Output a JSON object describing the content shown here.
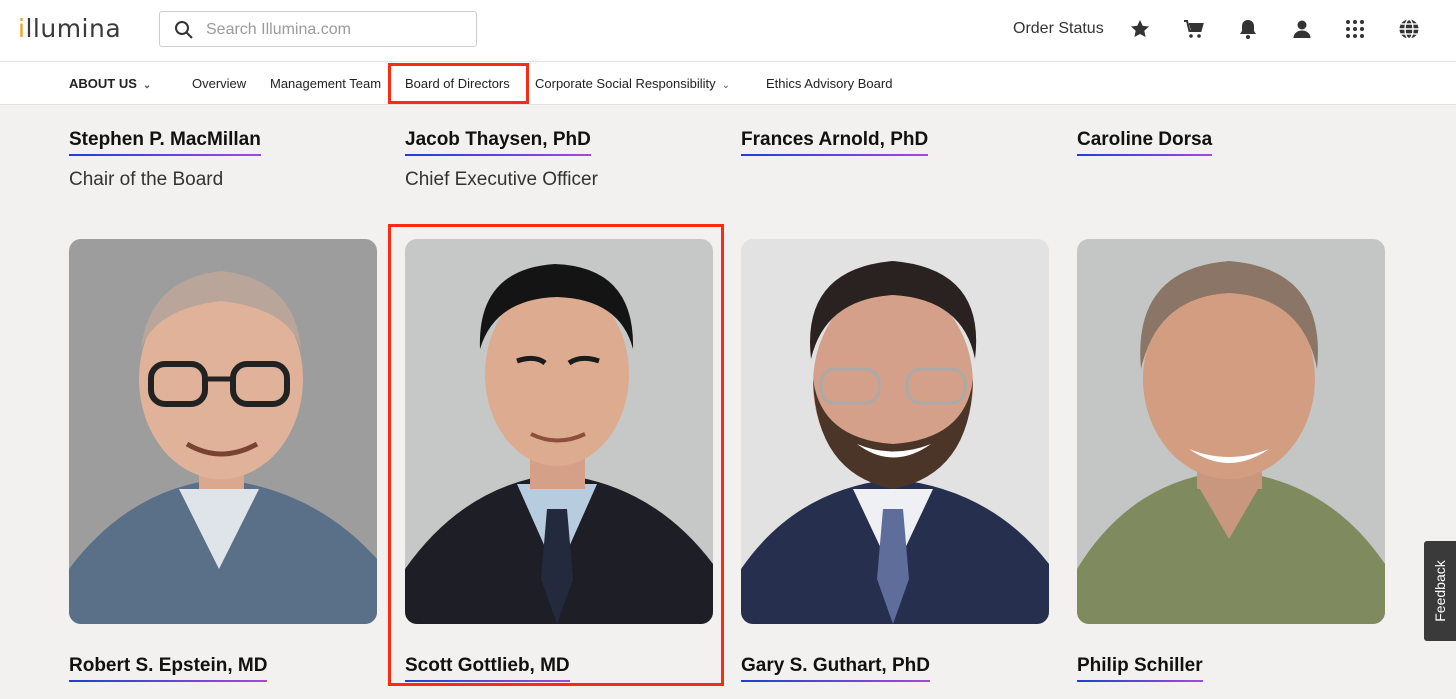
{
  "header": {
    "logo": {
      "prefix": "i",
      "rest": "llumina"
    },
    "search_placeholder": "Search Illumina.com",
    "order_status": "Order Status",
    "icons": [
      "search-icon",
      "star-icon",
      "cart-icon",
      "bell-icon",
      "user-icon",
      "apps-grid-icon",
      "globe-icon"
    ],
    "accent_color": "#f0a30a"
  },
  "subnav": {
    "about": "ABOUT US",
    "items": [
      "Overview",
      "Management Team",
      "Board of Directors",
      "Corporate Social Responsibility",
      "Ethics Advisory Board"
    ],
    "active": "Board of Directors",
    "highlight_color": "#ff2a12"
  },
  "board": {
    "row1": [
      {
        "name": "Stephen P. MacMillan",
        "title": "Chair of the Board"
      },
      {
        "name": "Jacob Thaysen, PhD",
        "title": "Chief Executive Officer"
      },
      {
        "name": "Frances Arnold, PhD",
        "title": ""
      },
      {
        "name": "Caroline Dorsa",
        "title": ""
      }
    ],
    "row2": [
      {
        "name": "Robert S. Epstein, MD"
      },
      {
        "name": "Scott Gottlieb, MD"
      },
      {
        "name": "Gary S. Guthart, PhD"
      },
      {
        "name": "Philip Schiller"
      }
    ]
  },
  "feedback_label": "Feedback"
}
